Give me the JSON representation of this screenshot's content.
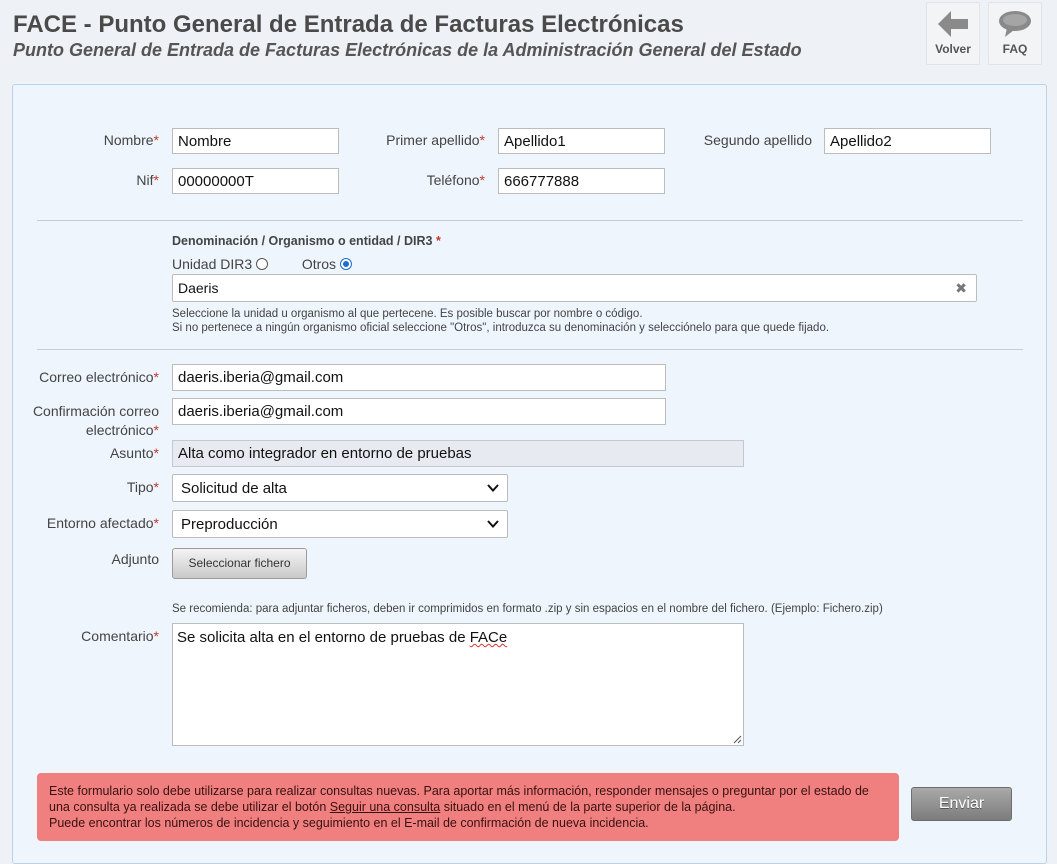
{
  "header": {
    "title": "FACE - Punto General de Entrada de Facturas Electrónicas",
    "subtitle": "Punto General de Entrada de Facturas Electrónicas de la Administración General del Estado",
    "back_label": "Volver",
    "faq_label": "FAQ"
  },
  "form": {
    "nombre": {
      "label": "Nombre",
      "value": "Nombre"
    },
    "apellido1": {
      "label": "Primer apellido",
      "value": "Apellido1"
    },
    "apellido2": {
      "label": "Segundo apellido",
      "value": "Apellido2"
    },
    "nif": {
      "label": "Nif",
      "value": "00000000T"
    },
    "telefono": {
      "label": "Teléfono",
      "value": "666777888"
    },
    "denominacion": {
      "label": "Denominación / Organismo o entidad / DIR3",
      "radio_dir3": "Unidad DIR3",
      "radio_otros": "Otros",
      "value": "Daeris",
      "clear_glyph": "✖",
      "help1": "Seleccione la unidad u organismo al que pertecene. Es posible buscar por nombre o código.",
      "help2": "Si no pertenece a ningún organismo oficial seleccione \"Otros\", introduzca su denominación y selecciónelo para que quede fijado."
    },
    "correo": {
      "label": "Correo electrónico",
      "value": "daeris.iberia@gmail.com"
    },
    "confirmacion": {
      "label_line1": "Confirmación correo",
      "label_line2": "electrónico",
      "value": "daeris.iberia@gmail.com"
    },
    "asunto": {
      "label": "Asunto",
      "value": "Alta como integrador en entorno de pruebas"
    },
    "tipo": {
      "label": "Tipo",
      "value": "Solicitud de alta"
    },
    "entorno": {
      "label": "Entorno afectado",
      "value": "Preproducción"
    },
    "adjunto": {
      "label": "Adjunto",
      "button": "Seleccionar fichero"
    },
    "adjunto_hint": "Se recomienda: para adjuntar ficheros, deben ir comprimidos en formato .zip y sin espacios en el nombre del fichero. (Ejemplo: Fichero.zip)",
    "comentario": {
      "label": "Comentario",
      "value_prefix": "Se solicita alta en el entorno de pruebas de ",
      "value_word": "FACe"
    },
    "required_mark": "*"
  },
  "warning": {
    "text1": "Este formulario solo debe utilizarse para realizar consultas nuevas. Para aportar más información, responder mensajes o preguntar por el estado de una consulta ya realizada se debe utilizar el botón ",
    "link": "Seguir una consulta",
    "text2": " situado en el menú de la parte superior de la página.",
    "text3": "Puede encontrar los números de incidencia y seguimiento en el E-mail de confirmación de nueva incidencia."
  },
  "submit_label": "Enviar",
  "icons": {
    "back": "arrow-left-icon",
    "faq": "speech-bubble-icon",
    "select": "chevron-down-icon",
    "clear": "clear-icon"
  }
}
